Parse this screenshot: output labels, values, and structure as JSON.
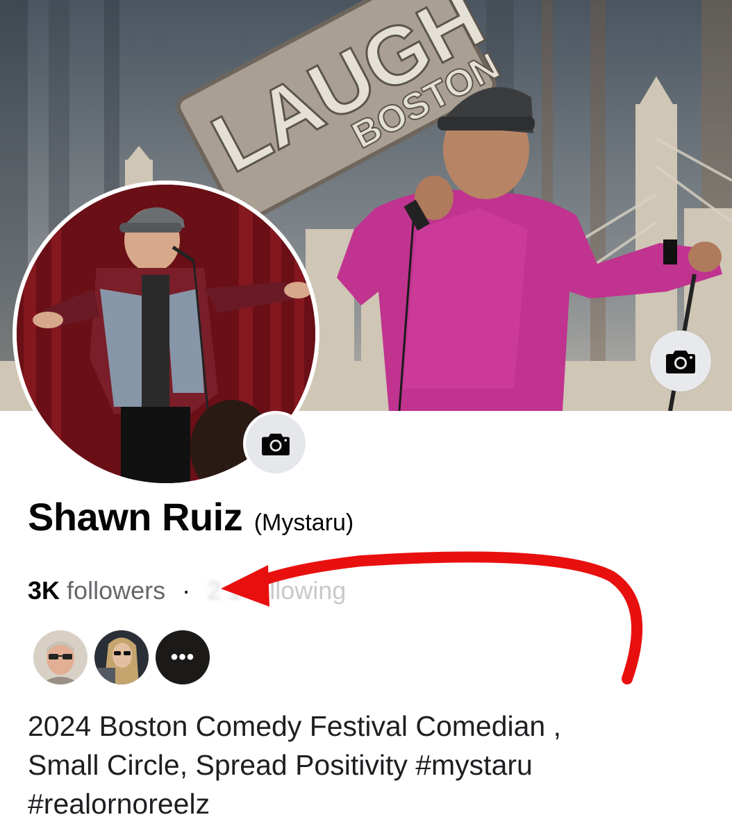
{
  "cover": {
    "sign_line1": "LAUGH",
    "sign_line2": "BOSTON",
    "camera_icon": "camera-icon"
  },
  "avatar": {
    "camera_icon": "camera-icon"
  },
  "profile": {
    "name": "Shawn Ruiz",
    "nickname": "(Mystaru)",
    "followers_count": "3K",
    "followers_label": "followers",
    "separator": "·",
    "following_count_obscured": "2 1",
    "following_label": "following"
  },
  "mutual_friends": {
    "more_label": "•••"
  },
  "bio": "2024 Boston Comedy Festival Comedian ,\nSmall Circle, Spread Positivity  #mystaru\n#realornoreelz",
  "annotation": {
    "arrow_color": "#e8100f"
  }
}
